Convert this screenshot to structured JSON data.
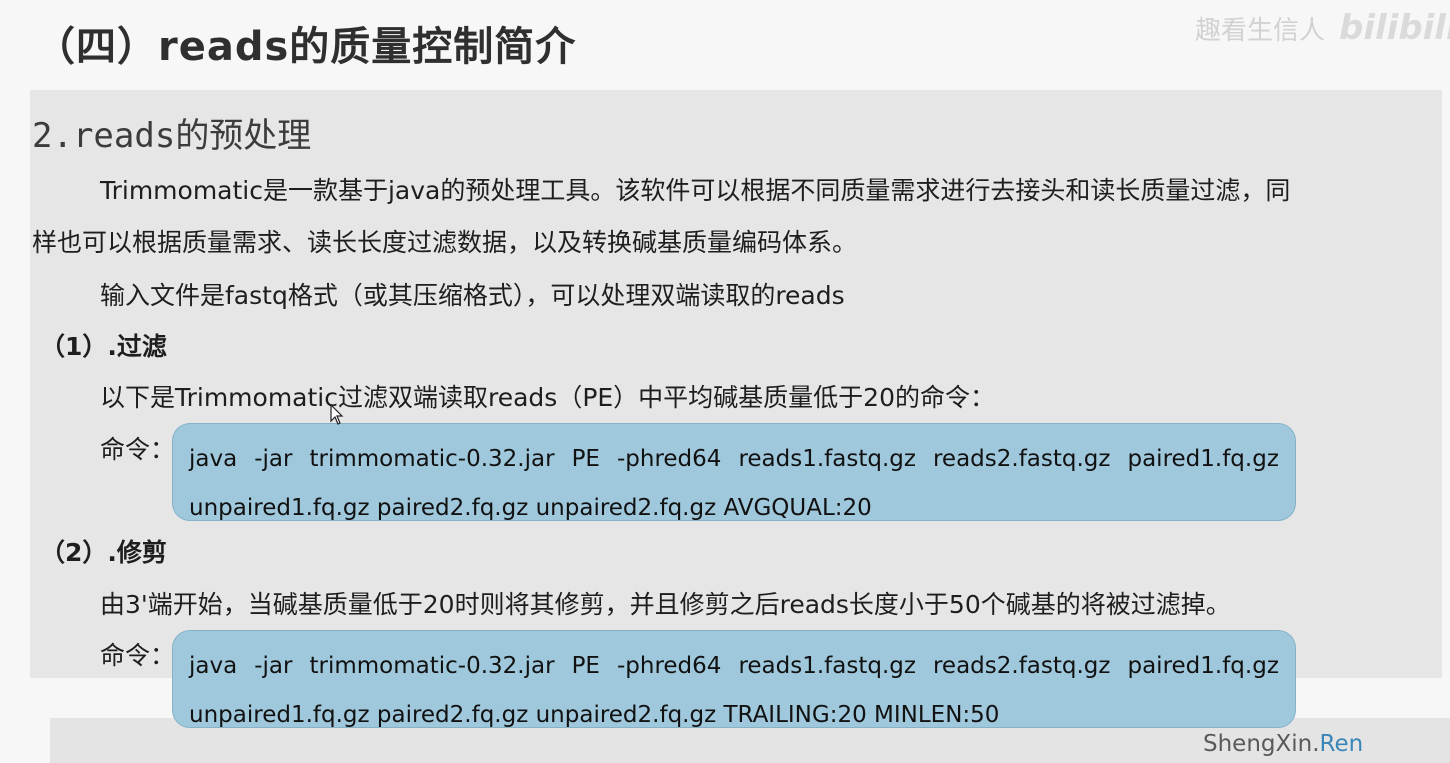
{
  "slide": {
    "title": "（四）reads的质量控制简介",
    "watermark_text": "趣看生信人",
    "watermark_logo": "bilibili",
    "section_number": "2.",
    "section_latin": "reads",
    "section_cn": "的预处理",
    "intro_line1": "Trimmomatic是一款基于java的预处理工具。该软件可以根据不同质量需求进行去接头和读长质量过滤，同",
    "intro_line2": "样也可以根据质量需求、读长长度过滤数据，以及转换碱基质量编码体系。",
    "input_line": "输入文件是fastq格式（或其压缩格式），可以处理双端读取的reads",
    "filter": {
      "heading": "（1）.过滤",
      "desc": "以下是Trimmomatic过滤双端读取reads（PE）中平均碱基质量低于20的命令：",
      "cmd_label": "命令：",
      "cmd_line1": [
        "java",
        "-jar",
        "trimmomatic-0.32.jar",
        "PE",
        "-phred64",
        "reads1.fastq.gz",
        "reads2.fastq.gz",
        "paired1.fq.gz"
      ],
      "cmd_line2": "unpaired1.fq.gz paired2.fq.gz unpaired2.fq.gz AVGQUAL:20"
    },
    "trim": {
      "heading": "（2）.修剪",
      "desc": "由3'端开始，当碱基质量低于20时则将其修剪，并且修剪之后reads长度小于50个碱基的将被过滤掉。",
      "cmd_label": "命令：",
      "cmd_line1": [
        "java",
        "-jar",
        "trimmomatic-0.32.jar",
        "PE",
        "-phred64",
        "reads1.fastq.gz",
        "reads2.fastq.gz",
        "paired1.fq.gz"
      ],
      "cmd_line2": "unpaired1.fq.gz paired2.fq.gz unpaired2.fq.gz TRAILING:20 MINLEN:50"
    },
    "brand_main": "ShengXin.",
    "brand_accent": "Ren"
  }
}
